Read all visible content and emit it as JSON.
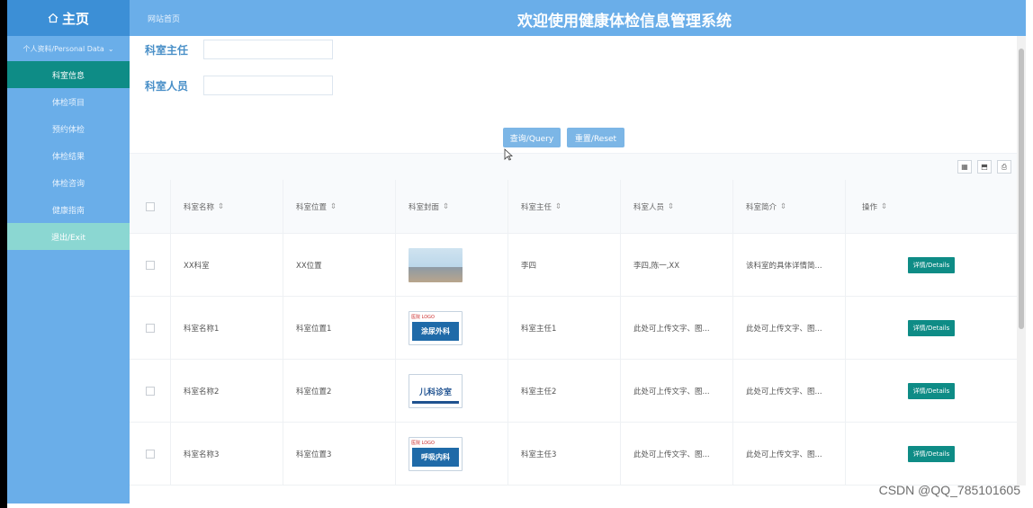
{
  "topbar": {
    "home_label": "主页",
    "home_icon": "home-icon",
    "breadcrumb": "网站首页",
    "system_title": "欢迎使用健康体检信息管理系统"
  },
  "sidebar": {
    "group_label": "个人资料/Personal Data",
    "items": [
      {
        "label": "科室信息",
        "active": true
      },
      {
        "label": "体检项目"
      },
      {
        "label": "预约体检"
      },
      {
        "label": "体检结果"
      },
      {
        "label": "体检咨询"
      },
      {
        "label": "健康指南"
      },
      {
        "label": "退出/Exit"
      }
    ]
  },
  "search": {
    "director_label": "科室主任",
    "director_value": "",
    "staff_label": "科室人员",
    "staff_value": "",
    "query_button": "查询/Query",
    "reset_button": "重置/Reset"
  },
  "table": {
    "headers": [
      "科室名称",
      "科室位置",
      "科室封面",
      "科室主任",
      "科室人员",
      "科室简介",
      "操作"
    ],
    "details_label": "详情/Details",
    "rows": [
      {
        "name": "XX科室",
        "location": "XX位置",
        "cover": "photo",
        "director": "李四",
        "staff": "李四,陈一,XX",
        "intro": "该科室的具体详情简..."
      },
      {
        "name": "科室名称1",
        "location": "科室位置1",
        "cover": "涂尿外科",
        "cover_top": "医院 LOGO",
        "director": "科室主任1",
        "staff": "此处可上传文字、图...",
        "intro": "此处可上传文字、图..."
      },
      {
        "name": "科室名称2",
        "location": "科室位置2",
        "cover": "儿科诊室",
        "director": "科室主任2",
        "staff": "此处可上传文字、图...",
        "intro": "此处可上传文字、图..."
      },
      {
        "name": "科室名称3",
        "location": "科室位置3",
        "cover": "呼吸内科",
        "cover_top": "医院 LOGO",
        "director": "科室主任3",
        "staff": "此处可上传文字、图...",
        "intro": "此处可上传文字、图..."
      }
    ]
  },
  "watermark": "CSDN @QQ_785101605",
  "colors": {
    "sidebar": "#6aaee9",
    "home_bg": "#3c8fd6",
    "active": "#0e8c86",
    "exit": "#8bd7d2",
    "button": "#7cb6e6"
  }
}
